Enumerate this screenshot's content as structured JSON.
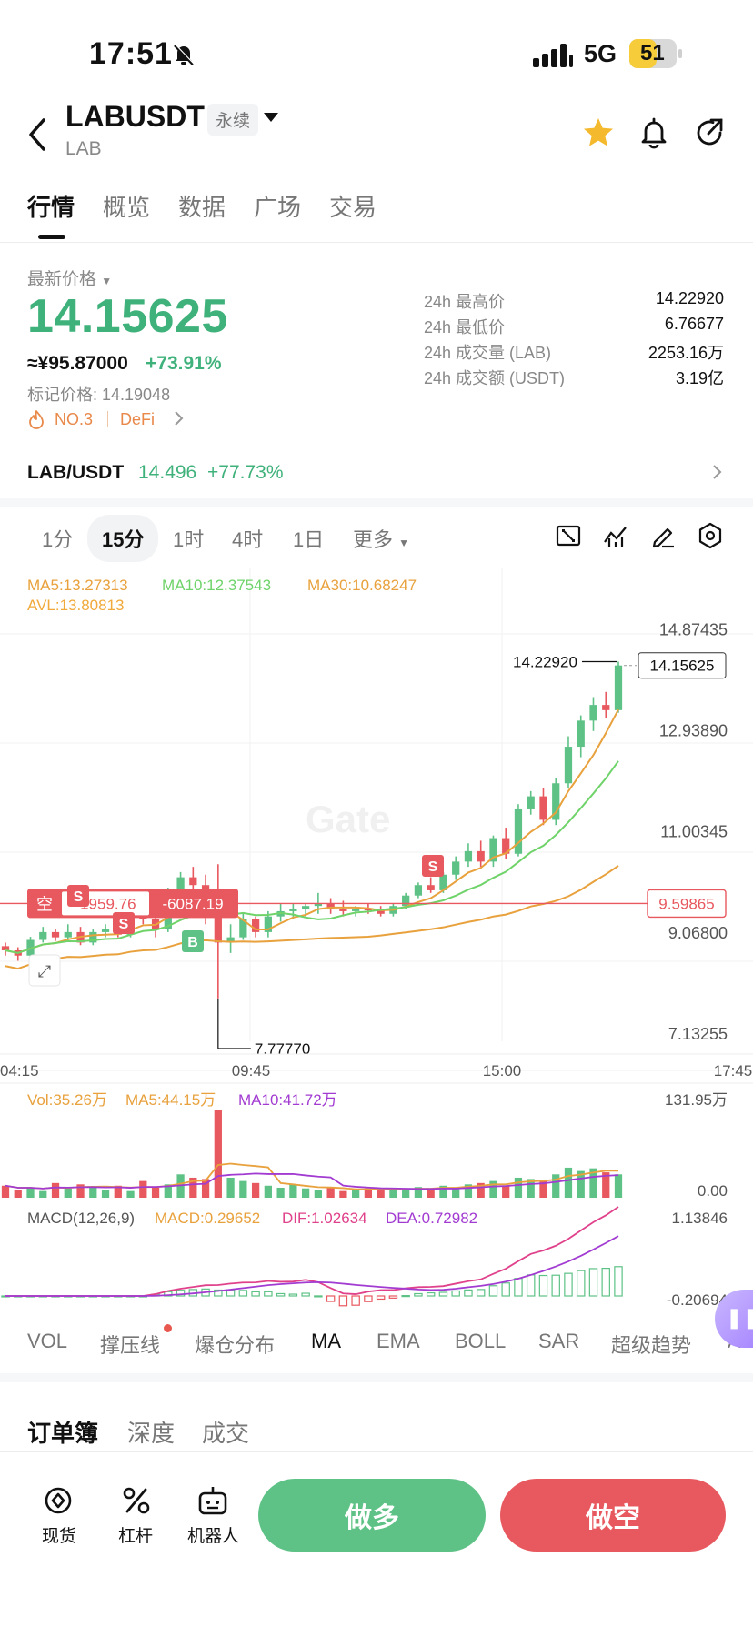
{
  "status": {
    "time": "17:51",
    "network": "5G",
    "battery": "51"
  },
  "header": {
    "symbol": "LABUSDT",
    "contract_type": "永续",
    "base": "LAB"
  },
  "tabs": [
    "行情",
    "概览",
    "数据",
    "广场",
    "交易"
  ],
  "price": {
    "label": "最新价格",
    "last": "14.15625",
    "cny": "≈¥95.87000",
    "change": "+73.91%",
    "mark_label": "标记价格: 14.19048",
    "rank": "NO.3",
    "sector": "DeFi"
  },
  "stats": [
    {
      "label": "24h 最高价",
      "value": "14.22920"
    },
    {
      "label": "24h 最低价",
      "value": "6.76677"
    },
    {
      "label": "24h 成交量 (LAB)",
      "value": "2253.16万"
    },
    {
      "label": "24h 成交额 (USDT)",
      "value": "3.19亿"
    }
  ],
  "spot_pair": {
    "pair": "LAB/USDT",
    "price": "14.496",
    "change": "+77.73%"
  },
  "intervals": [
    "1分",
    "15分",
    "1时",
    "4时",
    "1日",
    "更多"
  ],
  "active_interval": "15分",
  "ma_legend": {
    "ma5": "MA5:13.27313",
    "ma10": "MA10:12.37543",
    "ma30": "MA30:10.68247",
    "avl": "AVL:13.80813"
  },
  "axis": {
    "y_labels": [
      "14.87435",
      "12.93890",
      "11.00345",
      "9.06800",
      "7.13255"
    ],
    "x_labels": [
      "04:15",
      "09:45",
      "15:00",
      "17:45"
    ],
    "high_label": "14.22920",
    "low_label": "7.77770",
    "current_box": "14.15625",
    "position_line": "9.59865",
    "position_tag": "空",
    "position_pnl1": "-1959.76",
    "position_pnl2": "-6087.19",
    "signal_s": "S",
    "signal_b": "B",
    "watermark": "Gate"
  },
  "volume": {
    "label": "Vol:35.26万",
    "ma5": "MA5:44.15万",
    "ma10": "MA10:41.72万",
    "top": "131.95万",
    "bottom": "0.00"
  },
  "macd": {
    "label": "MACD(12,26,9)",
    "macd": "MACD:0.29652",
    "dif": "DIF:1.02634",
    "dea": "DEA:0.72982",
    "top": "1.13846",
    "bottom": "-0.20694"
  },
  "indicators": [
    "VOL",
    "撑压线",
    "爆仓分布",
    "MA",
    "EMA",
    "BOLL",
    "SAR",
    "超级趋势",
    "AV"
  ],
  "active_indicator": "MA",
  "orderbook_tabs": [
    "订单簿",
    "深度",
    "成交"
  ],
  "bottom": {
    "spot": "现货",
    "leverage": "杠杆",
    "robot": "机器人",
    "long": "做多",
    "short": "做空"
  },
  "colors": {
    "up": "#5ec286",
    "down": "#e8585f",
    "accent": "#3fb17b",
    "ma5": "#e8a13c",
    "ma10": "#6fd36a",
    "ma30": "#e8a13c",
    "avl": "#f0a93a"
  },
  "chart_data": {
    "type": "candlestick",
    "interval": "15分",
    "ylim": [
      7.13255,
      14.87435
    ],
    "candles": [
      [
        8.78,
        8.85,
        8.6,
        8.7
      ],
      [
        8.7,
        8.76,
        8.5,
        8.6
      ],
      [
        8.6,
        8.96,
        8.55,
        8.9
      ],
      [
        8.9,
        9.15,
        8.85,
        9.05
      ],
      [
        9.05,
        9.1,
        8.88,
        8.95
      ],
      [
        8.95,
        9.2,
        8.9,
        9.05
      ],
      [
        9.05,
        9.15,
        8.8,
        8.85
      ],
      [
        8.85,
        9.1,
        8.8,
        9.05
      ],
      [
        9.05,
        9.2,
        8.95,
        9.1
      ],
      [
        9.1,
        9.15,
        8.95,
        9.0
      ],
      [
        9.0,
        9.5,
        8.95,
        9.45
      ],
      [
        9.45,
        9.55,
        9.2,
        9.3
      ],
      [
        9.3,
        9.45,
        8.95,
        9.1
      ],
      [
        9.1,
        9.9,
        9.05,
        9.8
      ],
      [
        9.8,
        10.2,
        9.7,
        10.1
      ],
      [
        10.1,
        10.3,
        9.85,
        9.95
      ],
      [
        9.95,
        10.15,
        9.2,
        9.35
      ],
      [
        9.35,
        10.35,
        7.78,
        8.85
      ],
      [
        8.85,
        9.2,
        8.65,
        8.95
      ],
      [
        8.95,
        9.4,
        8.9,
        9.3
      ],
      [
        9.3,
        9.35,
        8.95,
        9.05
      ],
      [
        9.05,
        9.45,
        8.95,
        9.35
      ],
      [
        9.35,
        9.6,
        9.25,
        9.45
      ],
      [
        9.45,
        9.6,
        9.3,
        9.5
      ],
      [
        9.5,
        9.6,
        9.35,
        9.55
      ],
      [
        9.55,
        9.8,
        9.4,
        9.6
      ],
      [
        9.6,
        9.7,
        9.4,
        9.5
      ],
      [
        9.5,
        9.65,
        9.35,
        9.45
      ],
      [
        9.45,
        9.55,
        9.35,
        9.5
      ],
      [
        9.5,
        9.6,
        9.4,
        9.48
      ],
      [
        9.48,
        9.55,
        9.35,
        9.4
      ],
      [
        9.4,
        9.6,
        9.35,
        9.55
      ],
      [
        9.55,
        9.8,
        9.5,
        9.75
      ],
      [
        9.75,
        10.0,
        9.7,
        9.95
      ],
      [
        9.95,
        10.1,
        9.8,
        9.85
      ],
      [
        9.85,
        10.2,
        9.8,
        10.15
      ],
      [
        10.15,
        10.5,
        10.05,
        10.4
      ],
      [
        10.4,
        10.75,
        10.3,
        10.6
      ],
      [
        10.6,
        10.8,
        10.3,
        10.4
      ],
      [
        10.4,
        10.9,
        10.3,
        10.85
      ],
      [
        10.85,
        11.05,
        10.45,
        10.55
      ],
      [
        10.55,
        11.5,
        10.5,
        11.4
      ],
      [
        11.4,
        11.75,
        11.3,
        11.65
      ],
      [
        11.65,
        11.8,
        11.1,
        11.2
      ],
      [
        11.2,
        12.0,
        11.1,
        11.9
      ],
      [
        11.9,
        12.8,
        11.8,
        12.6
      ],
      [
        12.6,
        13.2,
        12.4,
        13.1
      ],
      [
        13.1,
        13.55,
        12.9,
        13.4
      ],
      [
        13.4,
        13.65,
        13.15,
        13.3
      ],
      [
        13.3,
        14.23,
        13.25,
        14.15625
      ]
    ],
    "volume": [
      18,
      12,
      15,
      10,
      22,
      14,
      20,
      16,
      12,
      18,
      10,
      25,
      15,
      20,
      35,
      30,
      28,
      132,
      30,
      25,
      22,
      18,
      15,
      20,
      14,
      12,
      16,
      10,
      12,
      14,
      11,
      15,
      12,
      16,
      14,
      18,
      15,
      20,
      22,
      25,
      18,
      30,
      28,
      25,
      35,
      45,
      40,
      44,
      38,
      35
    ]
  }
}
